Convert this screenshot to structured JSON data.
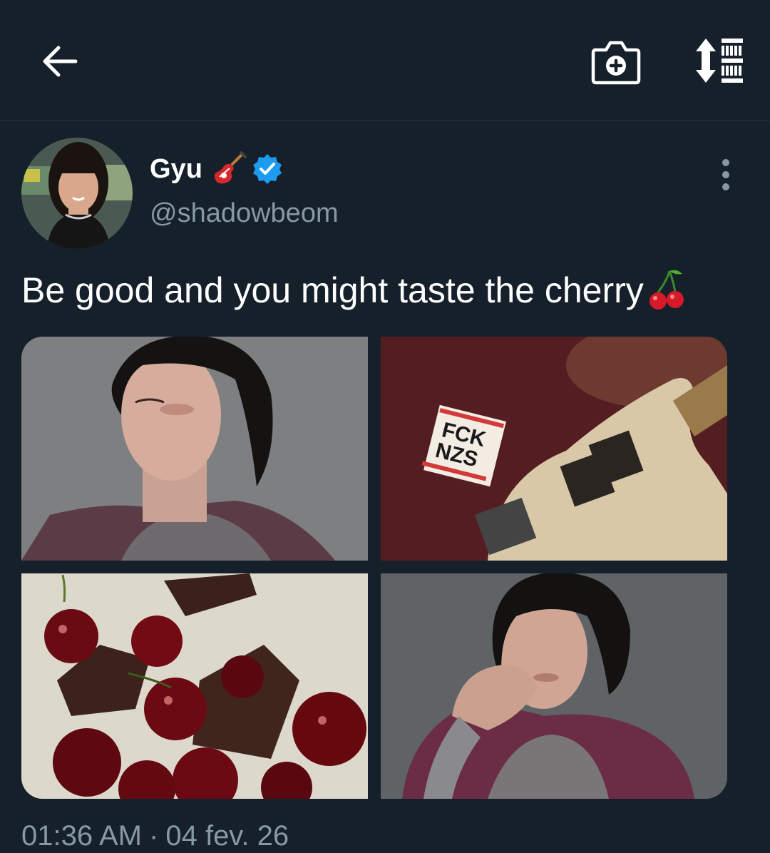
{
  "header": {
    "back_icon": "arrow-left-icon",
    "camera_icon": "camera-plus-icon",
    "sort_icon": "sort-list-icon"
  },
  "tweet": {
    "author": {
      "display_name": "Gyu",
      "name_emoji": "guitar-emoji",
      "verified_icon": "verified-badge-icon",
      "handle": "@shadowbeom"
    },
    "more_icon": "more-vertical-icon",
    "text": "Be good and you might taste the cherry",
    "text_emoji": "cherry-emoji",
    "media": [
      {
        "name": "photo-portrait-1"
      },
      {
        "name": "photo-guitar",
        "sticker_text": "FCK NZS"
      },
      {
        "name": "photo-cherries-chocolate"
      },
      {
        "name": "photo-portrait-2"
      }
    ],
    "time": "01:36 AM",
    "separator": "·",
    "date": "04 fev. 26"
  },
  "colors": {
    "background": "#15202b",
    "text_primary": "#ffffff",
    "text_secondary": "#8899a6",
    "verified": "#1d9bf0"
  }
}
